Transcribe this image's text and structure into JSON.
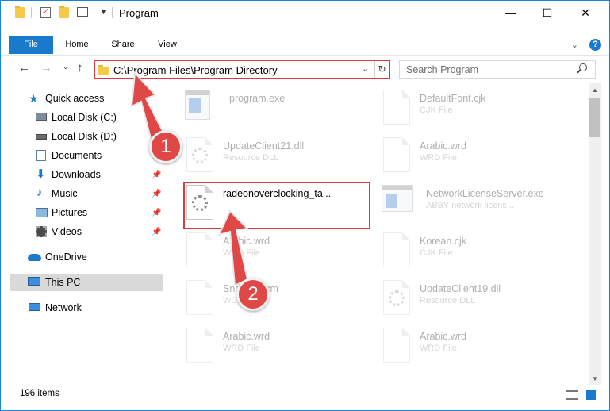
{
  "window": {
    "title": "Program",
    "minimize": "—",
    "maximize": "☐",
    "close": "✕"
  },
  "ribbon": {
    "tabs": [
      "File",
      "Home",
      "Share",
      "View"
    ],
    "help": "?"
  },
  "navigation": {
    "address": "C:\\Program Files\\Program Directory",
    "search_placeholder": "Search Program"
  },
  "sidebar": {
    "items": [
      {
        "label": "Quick access",
        "icon": "star-icon"
      },
      {
        "label": "Local Disk (C:)",
        "icon": "drive-icon"
      },
      {
        "label": "Local Disk (D:)",
        "icon": "drive-icon"
      },
      {
        "label": "Documents",
        "icon": "documents-icon",
        "pinned": true
      },
      {
        "label": "Downloads",
        "icon": "downloads-icon",
        "pinned": true
      },
      {
        "label": "Music",
        "icon": "music-icon",
        "pinned": true
      },
      {
        "label": "Pictures",
        "icon": "pictures-icon",
        "pinned": true
      },
      {
        "label": "Videos",
        "icon": "videos-icon",
        "pinned": true
      },
      {
        "label": "OneDrive",
        "icon": "cloud-icon"
      },
      {
        "label": "This PC",
        "icon": "computer-icon",
        "selected": true
      },
      {
        "label": "Network",
        "icon": "network-icon"
      }
    ]
  },
  "files": [
    {
      "name": "program.exe",
      "type": "",
      "faded": true
    },
    {
      "name": "DefaultFont.cjk",
      "type": "CJK File",
      "faded": true
    },
    {
      "name": "UpdateClient21.dll",
      "type": "Resource DLL",
      "faded": true
    },
    {
      "name": "Arabic.wrd",
      "type": "WRD File",
      "faded": true
    },
    {
      "name": "radeonoverclocking_ta...",
      "type": "",
      "faded": false
    },
    {
      "name": "NetworkLicenseServer.exe",
      "type": "ABBY network licens...",
      "faded": true
    },
    {
      "name": "Arabic.wrd",
      "type": "WRD File",
      "faded": true
    },
    {
      "name": "Korean.cjk",
      "type": "CJK File",
      "faded": true
    },
    {
      "name": "SndDrv.wcm",
      "type": "WCM File",
      "faded": true
    },
    {
      "name": "UpdateClient19.dll",
      "type": "Resource DLL",
      "faded": true
    },
    {
      "name": "Arabic.wrd",
      "type": "WRD File",
      "faded": true
    },
    {
      "name": "Arabic.wrd",
      "type": "WRD File",
      "faded": true
    }
  ],
  "status": {
    "item_count": "196 items"
  },
  "callouts": [
    "1",
    "2"
  ],
  "colors": {
    "accent": "#1979ca",
    "highlight": "#d9393f",
    "callout": "#e04848"
  }
}
